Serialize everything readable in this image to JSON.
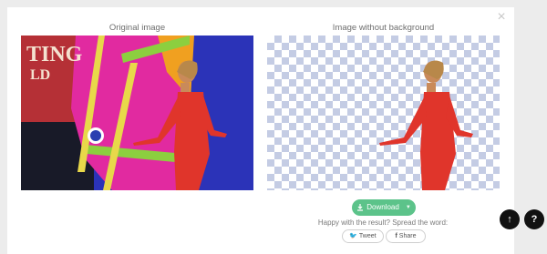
{
  "modal": {
    "close_icon": "×",
    "original_title": "Original image",
    "result_title": "Image without background"
  },
  "actions": {
    "download_label": "Download",
    "download_icon": "download-icon",
    "happy_text": "Happy with the result? Spread the word:",
    "tweet_label": "Tweet",
    "share_label": "Share"
  },
  "background_sign": {
    "line1": "TING",
    "line2": "LD"
  },
  "floating": {
    "up_icon": "↑",
    "help_icon": "?"
  },
  "colors": {
    "accent_green": "#5cc38a",
    "checker": "#c4cce4",
    "dress_red": "#e0352b"
  }
}
